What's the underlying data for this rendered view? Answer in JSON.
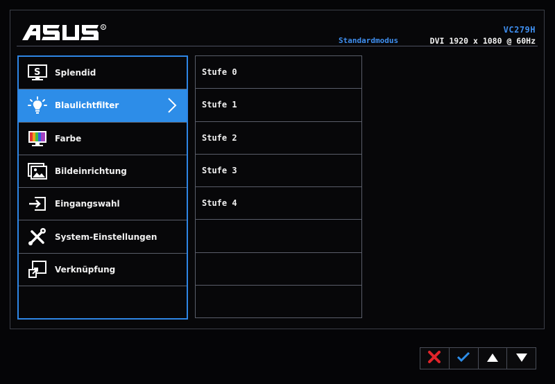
{
  "brand": "ASUS",
  "header": {
    "model": "VC279H",
    "mode": "Standardmodus",
    "signal": "DVI 1920 x 1080 @ 60Hz"
  },
  "main_menu": {
    "items": [
      {
        "label": "Splendid",
        "icon": "splendid-icon"
      },
      {
        "label": "Blaulichtfilter",
        "icon": "bulb-icon",
        "selected": true
      },
      {
        "label": "Farbe",
        "icon": "color-monitor-icon"
      },
      {
        "label": "Bildeinrichtung",
        "icon": "image-icon"
      },
      {
        "label": "Eingangswahl",
        "icon": "input-icon"
      },
      {
        "label": "System-Einstellungen",
        "icon": "tools-icon"
      },
      {
        "label": "Verknüpfung",
        "icon": "shortcut-icon"
      }
    ]
  },
  "sub_menu": {
    "items": [
      "Stufe 0",
      "Stufe 1",
      "Stufe 2",
      "Stufe 3",
      "Stufe 4",
      "",
      "",
      ""
    ]
  },
  "nav": {
    "buttons": [
      "close-icon",
      "check-icon",
      "up-arrow-icon",
      "down-arrow-icon"
    ]
  },
  "colors": {
    "accent": "#2d8de8",
    "highlight_text": "#3f8ff0",
    "close": "#e0242a"
  }
}
